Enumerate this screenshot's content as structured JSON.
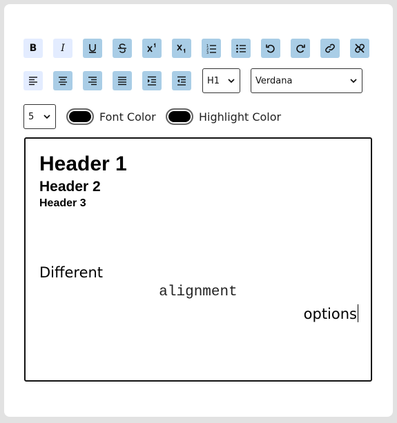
{
  "toolbar": {
    "row1": [
      {
        "name": "bold-button",
        "icon": "bold-icon",
        "text": "B",
        "style": "light"
      },
      {
        "name": "italic-button",
        "icon": "italic-icon",
        "text": "I",
        "style": "light"
      },
      {
        "name": "underline-button",
        "icon": "underline-icon",
        "style": "blue"
      },
      {
        "name": "strikethrough-button",
        "icon": "strikethrough-icon",
        "style": "blue"
      },
      {
        "name": "superscript-button",
        "icon": "superscript-icon",
        "style": "blue"
      },
      {
        "name": "subscript-button",
        "icon": "subscript-icon",
        "style": "blue"
      },
      {
        "name": "ordered-list-button",
        "icon": "ordered-list-icon",
        "style": "blue"
      },
      {
        "name": "unordered-list-button",
        "icon": "unordered-list-icon",
        "style": "blue"
      },
      {
        "name": "undo-button",
        "icon": "undo-icon",
        "style": "blue"
      },
      {
        "name": "redo-button",
        "icon": "redo-icon",
        "style": "blue"
      },
      {
        "name": "link-button",
        "icon": "link-icon",
        "style": "blue"
      },
      {
        "name": "unlink-button",
        "icon": "unlink-icon",
        "style": "blue"
      }
    ],
    "row2": [
      {
        "name": "align-left-button",
        "icon": "align-left-icon",
        "style": "light"
      },
      {
        "name": "align-center-button",
        "icon": "align-center-icon",
        "style": "blue"
      },
      {
        "name": "align-right-button",
        "icon": "align-right-icon",
        "style": "blue"
      },
      {
        "name": "justify-button",
        "icon": "justify-icon",
        "style": "blue"
      },
      {
        "name": "indent-button",
        "icon": "indent-icon",
        "style": "blue"
      },
      {
        "name": "outdent-button",
        "icon": "outdent-icon",
        "style": "blue"
      }
    ],
    "heading_select": {
      "value": "H1"
    },
    "font_select": {
      "value": "Verdana"
    },
    "size_select": {
      "value": "5"
    },
    "font_color_label": "Font Color",
    "highlight_color_label": "Highlight Color",
    "font_color": "#000000",
    "highlight_color": "#000000"
  },
  "editor": {
    "header1": "Header 1",
    "header2": "Header 2",
    "header3": "Header 3",
    "line1": "Different",
    "line2": "alignment",
    "line3": "options"
  },
  "colors": {
    "button_light": "#e3ecff",
    "button_blue": "#a9cde6",
    "page_bg": "#e2e2e2"
  }
}
